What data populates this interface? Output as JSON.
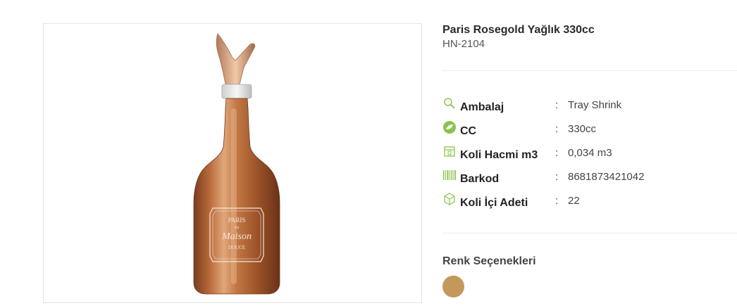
{
  "product": {
    "title": "Paris Rosegold Yağlık 330cc",
    "code": "HN-2104",
    "image_alt": "Paris Rosegold Yağlık 330cc",
    "label_text": {
      "line1": "PARIS",
      "line2": "La",
      "line3": "Maison",
      "line4": "DOUCE"
    }
  },
  "specs": [
    {
      "icon": "search-icon",
      "label": "Ambalaj",
      "colon": ":",
      "value": "Tray Shrink"
    },
    {
      "icon": "leaf-badge-icon",
      "label": "CC",
      "colon": ":",
      "value": "330cc"
    },
    {
      "icon": "box-icon",
      "label": "Koli Hacmi m3",
      "colon": ":",
      "value": "0,034 m3"
    },
    {
      "icon": "barcode-icon",
      "label": "Barkod",
      "colon": ":",
      "value": "8681873421042"
    },
    {
      "icon": "package-icon",
      "label": "Koli İçi Adeti",
      "colon": ":",
      "value": "22"
    }
  ],
  "colors": {
    "title": "Renk Seçenekleri",
    "options": [
      {
        "name": "Rosegold",
        "hex": "#c4975a"
      }
    ],
    "icon_green": "#8bc34a"
  }
}
